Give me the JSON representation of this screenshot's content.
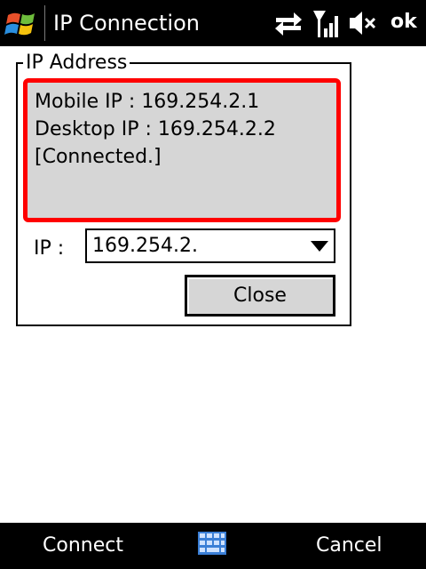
{
  "title_bar": {
    "title": "IP Connection",
    "ok_label": "ok",
    "icons": [
      "windows-start-icon",
      "sync-arrows-icon",
      "signal-strength-icon",
      "volume-muted-icon"
    ]
  },
  "group": {
    "legend": "IP Address",
    "status_lines": [
      "Mobile IP : 169.254.2.1",
      "Desktop IP : 169.254.2.2",
      "[Connected.]"
    ],
    "ip_label": "IP :",
    "ip_value": "169.254.2.",
    "close_label": "Close",
    "highlight_color": "#ff0000"
  },
  "softkeys": {
    "left": "Connect",
    "center_icon": "keyboard-icon",
    "right": "Cancel"
  }
}
